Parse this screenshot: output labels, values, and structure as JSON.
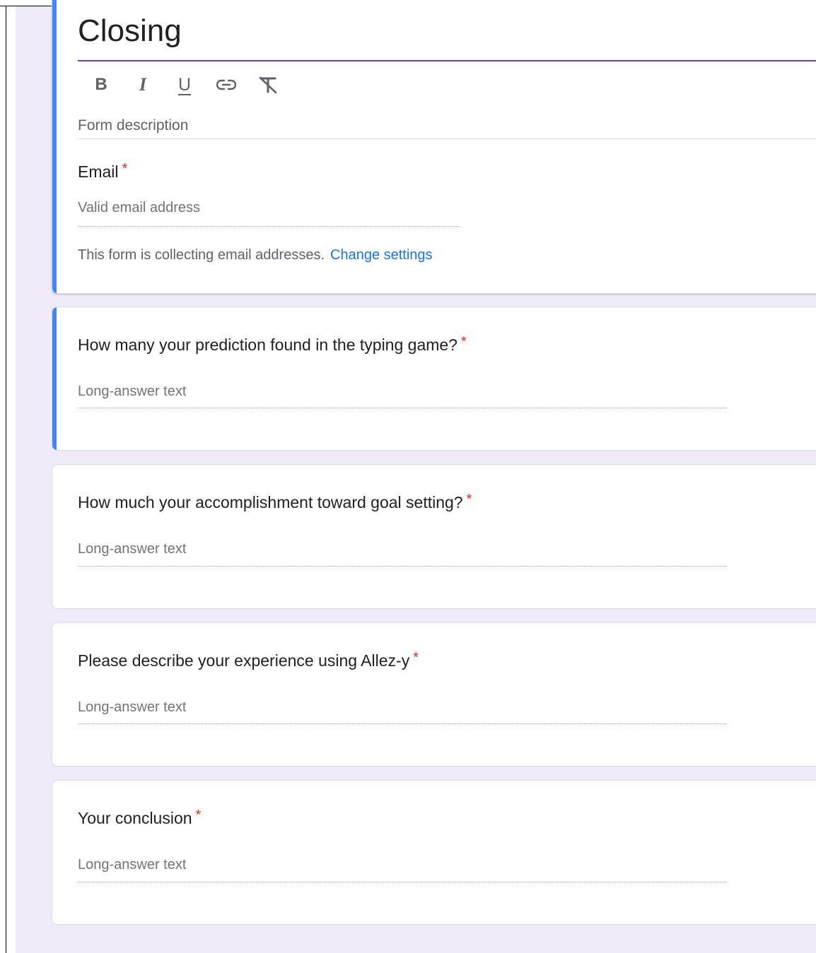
{
  "form": {
    "title": "Closing",
    "description_placeholder": "Form description",
    "toolbar": [
      {
        "name": "bold-icon",
        "label": "B"
      },
      {
        "name": "italic-icon",
        "label": "I"
      },
      {
        "name": "underline-icon",
        "label": "U"
      },
      {
        "name": "link-icon",
        "label": ""
      },
      {
        "name": "clear-format-icon",
        "label": ""
      }
    ]
  },
  "email": {
    "label": "Email",
    "required_mark": "*",
    "placeholder": "Valid email address",
    "notice": "This form is collecting email addresses.",
    "change_link": "Change settings"
  },
  "questions": [
    {
      "title": "How many your prediction found in the typing game?",
      "required_mark": "*",
      "placeholder": "Long-answer text"
    },
    {
      "title": "How much your accomplishment toward goal setting?",
      "required_mark": "*",
      "placeholder": "Long-answer text"
    },
    {
      "title": "Please describe your experience using Allez-y",
      "required_mark": "*",
      "placeholder": "Long-answer text"
    },
    {
      "title": "Your conclusion",
      "required_mark": "*",
      "placeholder": "Long-answer text"
    }
  ],
  "colors": {
    "accent_purple": "#673ab7",
    "active_blue": "#4285f4",
    "required_red": "#d93025",
    "link_blue": "#1a73e8",
    "background": "#efebf8"
  }
}
